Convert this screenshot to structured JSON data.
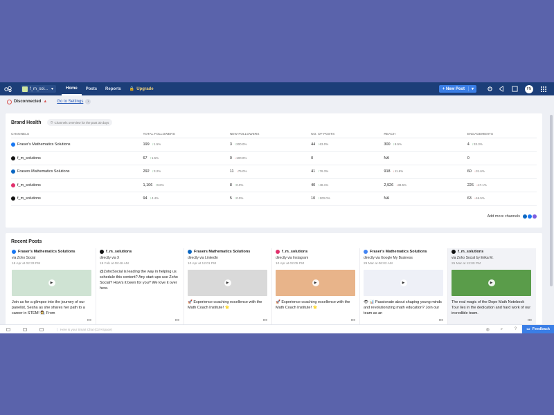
{
  "nav": {
    "brand_name": "f_m_sol...",
    "links": [
      "Home",
      "Posts",
      "Reports"
    ],
    "upgrade": "Upgrade",
    "new_post": "New Post",
    "avatar_initials": "FN"
  },
  "status": {
    "label": "Disconnected",
    "goto_settings": "Go to Settings"
  },
  "brand_health": {
    "title": "Brand Health",
    "tag": "Channels overview for the past 30 days",
    "columns": [
      "CHANNELS",
      "TOTAL FOLLOWERS",
      "NEW FOLLOWERS",
      "NO. OF POSTS",
      "REACH",
      "ENGAGEMENTS"
    ],
    "rows": [
      {
        "channel": "Fraser's Mathematics Solutions",
        "icon_color": "#1877f2",
        "total": "199",
        "total_d": "1.5%",
        "total_dir": "up",
        "new": "3",
        "new_d": "200.0%",
        "new_dir": "up",
        "posts": "44",
        "posts_d": "63.0%",
        "posts_dir": "up",
        "reach": "300",
        "reach_d": "8.5%",
        "reach_dir": "up",
        "eng": "4",
        "eng_d": "33.3%",
        "eng_dir": "up"
      },
      {
        "channel": "f_m_solutions",
        "icon_color": "#111111",
        "total": "67",
        "total_d": "1.5%",
        "total_dir": "up",
        "new": "0",
        "new_d": "100.0%",
        "new_dir": "down",
        "posts": "0",
        "posts_d": "",
        "posts_dir": "",
        "reach": "NA",
        "reach_d": "",
        "reach_dir": "",
        "eng": "0",
        "eng_d": "",
        "eng_dir": ""
      },
      {
        "channel": "Frasers Mathematics Solutions",
        "icon_color": "#0a66c2",
        "total": "292",
        "total_d": "3.2%",
        "total_dir": "up",
        "new": "11",
        "new_d": "75.0%",
        "new_dir": "down",
        "posts": "41",
        "posts_d": "76.3%",
        "posts_dir": "up",
        "reach": "918",
        "reach_d": "11.6%",
        "reach_dir": "down",
        "eng": "60",
        "eng_d": "31.6%",
        "eng_dir": "down"
      },
      {
        "channel": "f_m_solutions",
        "icon_color": "#e1306c",
        "total": "1,106",
        "total_d": "0.6%",
        "total_dir": "up",
        "new": "8",
        "new_d": "0.0%",
        "new_dir": "up",
        "posts": "40",
        "posts_d": "48.1%",
        "posts_dir": "up",
        "reach": "2,926",
        "reach_d": "38.5%",
        "reach_dir": "down",
        "eng": "226",
        "eng_d": "47.1%",
        "eng_dir": "down"
      },
      {
        "channel": "f_m_solutions",
        "icon_color": "#111111",
        "total": "94",
        "total_d": "4.4%",
        "total_dir": "up",
        "new": "5",
        "new_d": "0.0%",
        "new_dir": "up",
        "posts": "10",
        "posts_d": "100.0%",
        "posts_dir": "up",
        "reach": "NA",
        "reach_d": "",
        "reach_dir": "",
        "eng": "63",
        "eng_d": "46.5%",
        "eng_dir": "down"
      }
    ],
    "add_more": "Add more channels"
  },
  "recent_posts": {
    "title": "Recent Posts",
    "posts": [
      {
        "name": "Fraser's Mathematics Solutions",
        "icon_color": "#1877f2",
        "via": "via Zoho Social",
        "date": "18 Apr at 02:33 PM",
        "thumb_color": "#cfe3d3",
        "text": "Join us for a glimpse into the journey of our panelist, Sesha as she shares her path to a career in STEM! 👩‍🔬 From"
      },
      {
        "name": "f_m_solutions",
        "icon_color": "#111111",
        "via": "directly via X",
        "date": "19 Feb at 08:46 AM",
        "thumb_color": "",
        "text": "@ZohoSocial is leading the way in helping us schedule this content? Any start-ups use Zoho Social? How's it been for you? We love it over here."
      },
      {
        "name": "Frasers Mathematics Solutions",
        "icon_color": "#0a66c2",
        "via": "directly via LinkedIn",
        "date": "10 Apr at 12:01 PM",
        "thumb_color": "#d9d9d9",
        "text": "🚀 Experience coaching excellence with the Math Coach Institute! ⭐"
      },
      {
        "name": "f_m_solutions",
        "icon_color": "#e1306c",
        "via": "directly via Instagram",
        "date": "10 Apr at 02:05 PM",
        "thumb_color": "#e8b48a",
        "text": "🚀 Experience coaching excellence with the Math Coach Institute! ⭐"
      },
      {
        "name": "Fraser's Mathematics Solutions",
        "icon_color": "#4285f4",
        "via": "directly via Google My Business",
        "date": "29 Mar at 06:02 AM",
        "thumb_color": "#eef0f7",
        "text": "👁 📊 Passionate about shaping young minds and revolutionizing math education? Join our team as an"
      },
      {
        "name": "f_m_solutions",
        "icon_color": "#111111",
        "via": "via Zoho Social by Erika M.",
        "date": "25 Mar at 12:00 PM",
        "thumb_color": "#5a9c4a",
        "text": "The real magic of the Dope Math Notebook Tour lies in the dedication and hard work of our incredible team."
      }
    ]
  },
  "bottom": {
    "chat_placeholder": "Here is your Smart Chat (Ctrl+Space)",
    "feedback": "Feedback"
  }
}
